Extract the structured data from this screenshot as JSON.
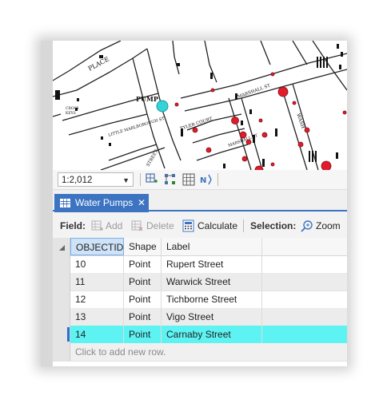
{
  "map": {
    "place_label": "PLACE",
    "pump_label": "PUMP",
    "street_labels": [
      "MARSHALL ST",
      "WASH",
      "TYLER COURT",
      "STREET",
      "LITTLE MARLBOROUGH ST",
      "MARSHALL ST",
      "CROSS"
    ],
    "scale_value": "1:2,012"
  },
  "tab": {
    "title": "Water Pumps",
    "close_glyph": "✕"
  },
  "fieldbar": {
    "field_label": "Field:",
    "add_label": "Add",
    "delete_label": "Delete",
    "calculate_label": "Calculate",
    "selection_label": "Selection:",
    "zoom_label": "Zoom T"
  },
  "table": {
    "columns": [
      "OBJECTID",
      "Shape",
      "Label"
    ],
    "rows": [
      {
        "objectid": "10",
        "shape": "Point",
        "label": "Rupert Street"
      },
      {
        "objectid": "11",
        "shape": "Point",
        "label": "Warwick Street"
      },
      {
        "objectid": "12",
        "shape": "Point",
        "label": "Tichborne Street"
      },
      {
        "objectid": "13",
        "shape": "Point",
        "label": "Vigo Street"
      },
      {
        "objectid": "14",
        "shape": "Point",
        "label": "Carnaby Street"
      }
    ],
    "selected_objectid": "14",
    "add_row_text": "Click to add new row."
  },
  "colors": {
    "accent": "#3c74c2",
    "selected_row": "#5ef3f3",
    "cholera_dot": "#e21b2b",
    "pump_highlight": "#33d3d8"
  }
}
